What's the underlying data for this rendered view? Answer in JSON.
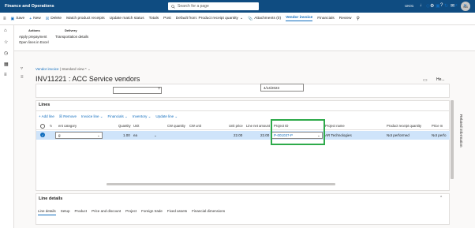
{
  "app": {
    "title": "Finance and Operations",
    "search_placeholder": "Search for a page",
    "org": "UK01",
    "avatar": "SG"
  },
  "actionbar": {
    "items": [
      "Save",
      "New",
      "Delete",
      "Match product receipts",
      "Update match status",
      "Totals",
      "Post",
      "Default from: Product receipt quantity",
      "Attachments (0)",
      "Vendor invoice",
      "Financials",
      "Review"
    ]
  },
  "menu": {
    "actions_head": "Actions",
    "actions": [
      "Apply prepayment",
      "Open lines in Excel"
    ],
    "delivery_head": "Delivery",
    "delivery": [
      "Transportation details"
    ]
  },
  "header": {
    "breadcrumb_link": "Vendor invoice",
    "breadcrumb_view": "Standard view *",
    "title": "INV11221 : ACC Service vendors",
    "he": "He...",
    "date": "4/14/2023",
    "related": "Related information"
  },
  "lines": {
    "title": "Lines",
    "toolbar": [
      "+ Add line",
      "Remove",
      "Invoice line",
      "Financials",
      "Inventory",
      "Update line"
    ],
    "columns": [
      "ent category",
      "Quantity",
      "Unit",
      "CW quantity",
      "CW unit",
      "Unit price",
      "Line net amount",
      "Project ID",
      "Project name",
      "Product receipt quantity",
      "Price m"
    ],
    "row": {
      "category": "g",
      "quantity": "1.00",
      "unit": "ea",
      "unit_price": "22.00",
      "net_amount": "22.00",
      "project_id": "P-001037-P",
      "project_name": "AR Technologies",
      "receipt_qty": "Not performed",
      "price_m": "Not perfo"
    }
  },
  "line_details": {
    "title": "Line details",
    "tabs": [
      "Line details",
      "Setup",
      "Product",
      "Price and discount",
      "Project",
      "Foreign trade",
      "Fixed assets",
      "Financial dimensions"
    ]
  },
  "colors": {
    "brand": "#0f4c81",
    "accent": "#0f6cbd",
    "highlight": "#2eaa4a",
    "selected_row": "#cfe4fa"
  }
}
